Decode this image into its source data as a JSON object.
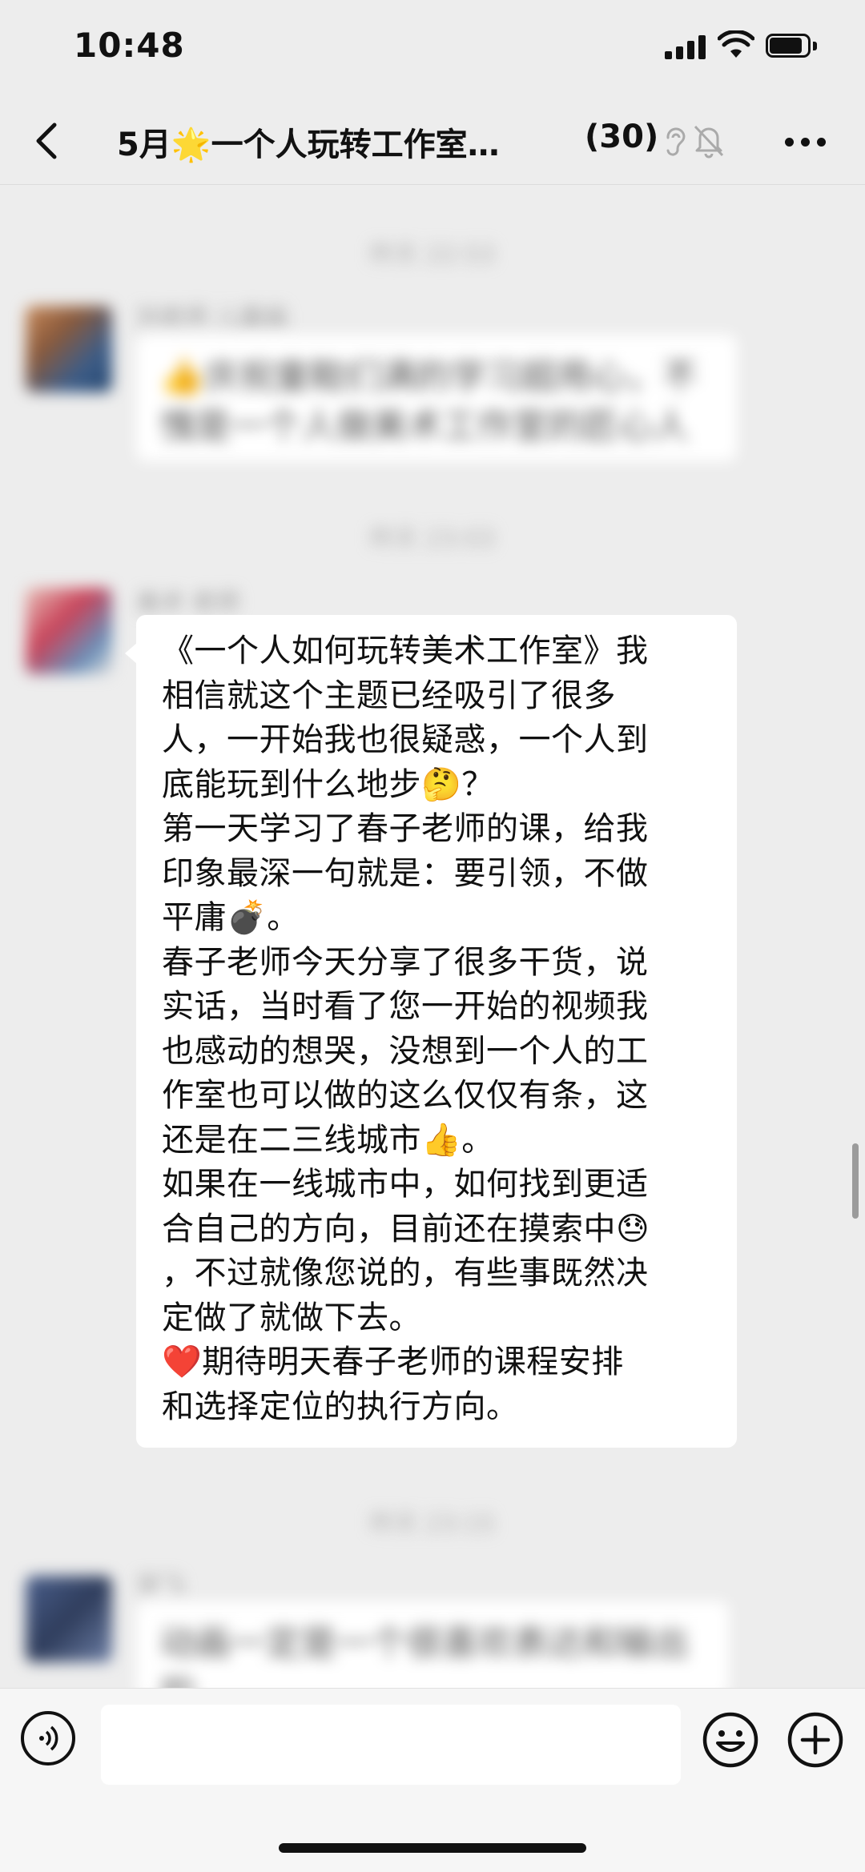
{
  "status_bar": {
    "time": "10:48"
  },
  "header": {
    "title": "5月🌟一个人玩转工作室…",
    "member_count": "(30)",
    "icons": [
      "back-icon",
      "ear-icon",
      "mute-bell-icon",
      "more-icon"
    ]
  },
  "messages": [
    {
      "type": "blurred",
      "timestamp": "昨天 22:53",
      "sender": "刘老师 儿童画",
      "text": "👍庆祝童鞋们满的学习超用心，不愧是一个人做美术工作室的匠心人"
    },
    {
      "type": "blurred",
      "timestamp": "昨天 23:03",
      "sender": "美术 老师"
    },
    {
      "type": "text",
      "lines": [
        "《一个人如何玩转美术工作室》我",
        "相信就这个主题已经吸引了很多",
        "人，一开始我也很疑惑，一个人到",
        "底能玩到什么地步🤔？",
        "第一天学习了春子老师的课，给我",
        "印象最深一句就是：要引领，不做",
        "平庸💣。",
        "春子老师今天分享了很多干货，说",
        "实话，当时看了您一开始的视频我",
        "也感动的想哭，没想到一个人的工",
        "作室也可以做的这么仅仅有条，这",
        "还是在二三线城市👍。",
        "如果在一线城市中，如何找到更适",
        "合自己的方向，目前还在摸索中😓",
        "，不过就像您说的，有些事既然决",
        "定做了就做下去。",
        "❤️期待明天春子老师的课程安排",
        "和选择定位的执行方向。"
      ]
    },
    {
      "type": "blurred",
      "timestamp": "昨天 23:15",
      "sender": "学飞",
      "text": "动画一定是一个很喜欢表达和输出的"
    }
  ],
  "input_bar": {
    "icons": [
      "voice-icon",
      "emoji-icon",
      "plus-icon"
    ]
  }
}
